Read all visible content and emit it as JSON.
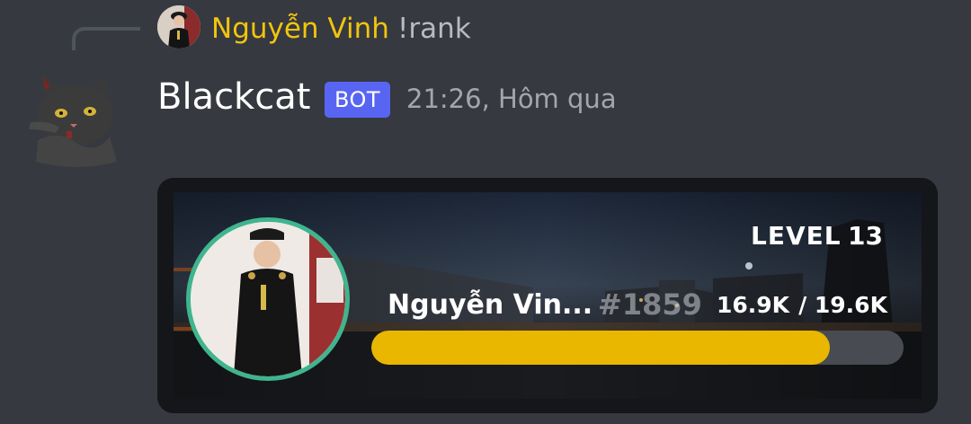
{
  "reply": {
    "author": "Nguyễn Vinh",
    "content": "!rank"
  },
  "message": {
    "author": "Blackcat",
    "badge": "BOT",
    "timestamp": "21:26, Hôm qua"
  },
  "rank_card": {
    "level_label": "LEVEL",
    "level": "13",
    "name": "Nguyễn Vin...",
    "rank": "#1859",
    "xp_current": "16.9K",
    "xp_total": "/ 19.6K",
    "progress_fraction": 0.862,
    "colors": {
      "progress": "#e9b700",
      "track": "#484b51",
      "avatar_ring": "#3fb58e"
    }
  },
  "colors": {
    "background": "#36393f",
    "reply_name": "#f1c40f",
    "bot_badge": "#5865f2"
  }
}
